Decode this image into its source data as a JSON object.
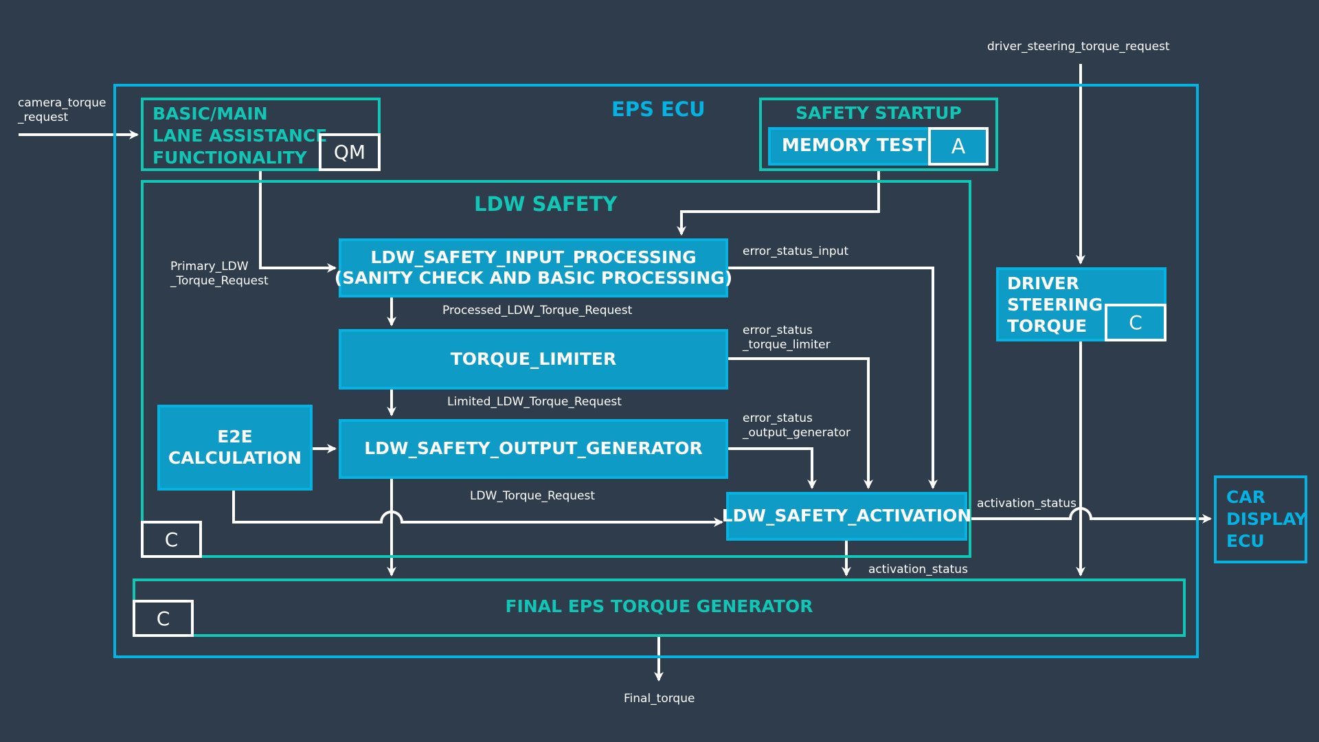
{
  "diagram": {
    "eps_ecu": {
      "title": "EPS ECU"
    },
    "basic_main": {
      "title": "BASIC/MAIN\nLANE ASSISTANCE\nFUNCTIONALITY",
      "asil": "QM"
    },
    "safety_startup": {
      "title": "SAFETY STARTUP",
      "memory_test": "MEMORY TEST",
      "asil": "A"
    },
    "ldw_safety": {
      "title": "LDW SAFETY",
      "asil": "C"
    },
    "input_processing": {
      "title": "LDW_SAFETY_INPUT_PROCESSING\n(SANITY CHECK AND BASIC PROCESSING)"
    },
    "torque_limiter": {
      "title": "TORQUE_LIMITER"
    },
    "output_generator": {
      "title": "LDW_SAFETY_OUTPUT_GENERATOR"
    },
    "e2e": {
      "title": "E2E\nCALCULATION"
    },
    "activation": {
      "title": "LDW_SAFETY_ACTIVATION"
    },
    "driver_steering": {
      "title": "DRIVER\nSTEERING\nTORQUE",
      "asil": "C"
    },
    "final_generator": {
      "title": "FINAL EPS TORQUE GENERATOR",
      "asil": "C"
    },
    "car_display": {
      "title": "CAR\nDISPLAY\nECU"
    }
  },
  "signals": {
    "camera_torque_request": "camera_torque\n_request",
    "driver_steering_torque_request": "driver_steering_torque_request",
    "primary_ldw": "Primary_LDW\n_Torque_Request",
    "processed": "Processed_LDW_Torque_Request",
    "limited": "Limited_LDW_Torque_Request",
    "ldw_torque_request": "LDW_Torque_Request",
    "error_status_input": "error_status_input",
    "error_status_torque_limiter": "error_status\n_torque_limiter",
    "error_status_output_generator": "error_status\n_output_generator",
    "activation_status_display": "activation_status",
    "activation_status_final": "activation_status",
    "final_torque": "Final_torque"
  },
  "colors": {
    "background": "#2f3c4b",
    "ecu_border": "#05b3e3",
    "teal": "#11c6b5",
    "block_fill": "#0e9bc6",
    "arrow": "#ffffff"
  }
}
